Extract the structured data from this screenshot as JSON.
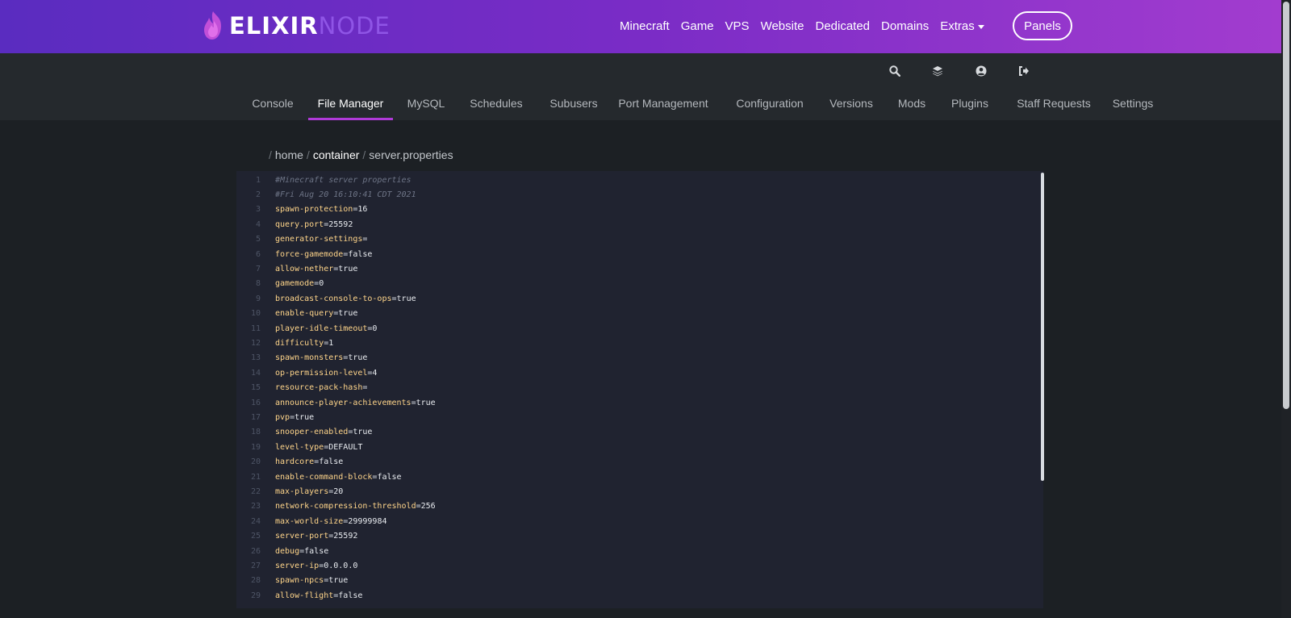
{
  "brand": {
    "name_bold": "ELIXIR",
    "name_light": "NODE",
    "accent": "#a23ccf"
  },
  "main_nav": {
    "items": [
      "Minecraft",
      "Game",
      "VPS",
      "Website",
      "Dedicated",
      "Domains"
    ],
    "extras_label": "Extras",
    "panels_label": "Panels"
  },
  "toolbar_icons": [
    "search-icon",
    "layers-icon",
    "account-icon",
    "logout-icon"
  ],
  "tabs": {
    "items": [
      "Console",
      "File Manager",
      "MySQL",
      "Schedules",
      "Subusers",
      "Port Management",
      "Configuration",
      "Versions",
      "Mods",
      "Plugins",
      "Staff Requests",
      "Settings"
    ],
    "active": "File Manager"
  },
  "breadcrumb": {
    "separator": "/",
    "parts": [
      "home",
      "container",
      "server.properties"
    ]
  },
  "editor": {
    "lines": [
      {
        "n": "1",
        "comment": "#Minecraft server properties"
      },
      {
        "n": "2",
        "comment": "#Fri Aug 20 16:10:41 CDT 2021"
      },
      {
        "n": "3",
        "key": "spawn-protection",
        "value": "16"
      },
      {
        "n": "4",
        "key": "query.port",
        "value": "25592"
      },
      {
        "n": "5",
        "key": "generator-settings",
        "value": ""
      },
      {
        "n": "6",
        "key": "force-gamemode",
        "value": "false"
      },
      {
        "n": "7",
        "key": "allow-nether",
        "value": "true"
      },
      {
        "n": "8",
        "key": "gamemode",
        "value": "0"
      },
      {
        "n": "9",
        "key": "broadcast-console-to-ops",
        "value": "true"
      },
      {
        "n": "10",
        "key": "enable-query",
        "value": "true"
      },
      {
        "n": "11",
        "key": "player-idle-timeout",
        "value": "0"
      },
      {
        "n": "12",
        "key": "difficulty",
        "value": "1"
      },
      {
        "n": "13",
        "key": "spawn-monsters",
        "value": "true"
      },
      {
        "n": "14",
        "key": "op-permission-level",
        "value": "4"
      },
      {
        "n": "15",
        "key": "resource-pack-hash",
        "value": ""
      },
      {
        "n": "16",
        "key": "announce-player-achievements",
        "value": "true"
      },
      {
        "n": "17",
        "key": "pvp",
        "value": "true"
      },
      {
        "n": "18",
        "key": "snooper-enabled",
        "value": "true"
      },
      {
        "n": "19",
        "key": "level-type",
        "value": "DEFAULT"
      },
      {
        "n": "20",
        "key": "hardcore",
        "value": "false"
      },
      {
        "n": "21",
        "key": "enable-command-block",
        "value": "false"
      },
      {
        "n": "22",
        "key": "max-players",
        "value": "20"
      },
      {
        "n": "23",
        "key": "network-compression-threshold",
        "value": "256"
      },
      {
        "n": "24",
        "key": "max-world-size",
        "value": "29999984"
      },
      {
        "n": "25",
        "key": "server-port",
        "value": "25592"
      },
      {
        "n": "26",
        "key": "debug",
        "value": "false"
      },
      {
        "n": "27",
        "key": "server-ip",
        "value": "0.0.0.0"
      },
      {
        "n": "28",
        "key": "spawn-npcs",
        "value": "true"
      },
      {
        "n": "29",
        "key": "allow-flight",
        "value": "false"
      }
    ]
  }
}
